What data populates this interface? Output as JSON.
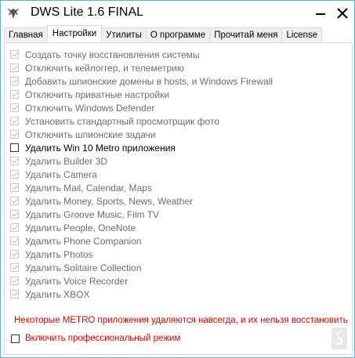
{
  "window": {
    "title": "DWS Lite 1.6 FINAL",
    "app_icon": "wolf-logo-icon",
    "minimize_icon": "minimize-icon",
    "close_icon": "close-icon",
    "border_color": "#60b0d8"
  },
  "tabs": [
    {
      "label": "Главная",
      "active": false
    },
    {
      "label": "Настройки",
      "active": true
    },
    {
      "label": "Утилиты",
      "active": false
    },
    {
      "label": "О программе",
      "active": false
    },
    {
      "label": "Прочитай меня",
      "active": false
    },
    {
      "label": "License",
      "active": false
    }
  ],
  "options": [
    {
      "label": "Создать точку восстановления системы",
      "checked": true,
      "enabled": false
    },
    {
      "label": "Отключить кейлоггер, и телеметрию",
      "checked": true,
      "enabled": false
    },
    {
      "label": "Добавить шпионские домены в hosts, и Windows Firewall",
      "checked": true,
      "enabled": false
    },
    {
      "label": "Отключить приватные настройки",
      "checked": true,
      "enabled": false
    },
    {
      "label": "Отключить Windows Defender",
      "checked": true,
      "enabled": false
    },
    {
      "label": "Установить стандартный просмотрщик фото",
      "checked": true,
      "enabled": false
    },
    {
      "label": "Отключить шпионские задачи",
      "checked": true,
      "enabled": false
    },
    {
      "label": "Удалить Win 10 Metro приложения",
      "checked": false,
      "enabled": true
    },
    {
      "label": "Удалить Builder 3D",
      "checked": true,
      "enabled": false
    },
    {
      "label": "Удалить Camera",
      "checked": true,
      "enabled": false
    },
    {
      "label": "Удалить Mail, Calendar, Maps",
      "checked": true,
      "enabled": false
    },
    {
      "label": "Удалить Money, Sports, News, Weather",
      "checked": true,
      "enabled": false
    },
    {
      "label": "Удалить Groove Music, Film TV",
      "checked": true,
      "enabled": false
    },
    {
      "label": "Удалить People, OneNote",
      "checked": true,
      "enabled": false
    },
    {
      "label": "Удалить Phone Companion",
      "checked": true,
      "enabled": false
    },
    {
      "label": "Удалить Photos",
      "checked": true,
      "enabled": false
    },
    {
      "label": "Удалить Solitaire Collection",
      "checked": true,
      "enabled": false
    },
    {
      "label": "Удалить Voice Recorder",
      "checked": true,
      "enabled": false
    },
    {
      "label": "Удалить XBOX",
      "checked": true,
      "enabled": false
    }
  ],
  "warning": {
    "text": "Некоторые METRO приложения удаляются навсегда, и их нельзя восстановить",
    "color": "#e00000"
  },
  "pro_mode": {
    "label": "Включить профессиональный режим",
    "checked": false,
    "color": "#e00000"
  },
  "corner_badge": {
    "icon": "scroll-glyph-icon"
  }
}
